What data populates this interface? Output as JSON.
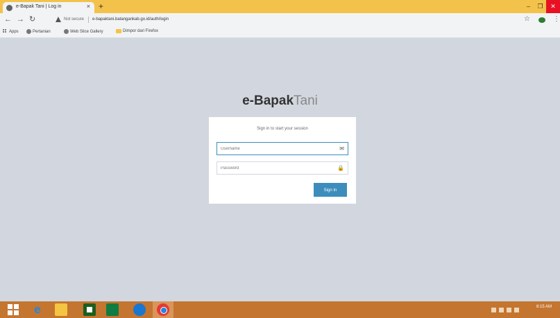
{
  "browser": {
    "tab_title": "e-Bapak Tani | Log in",
    "address": {
      "security_label": "Not secure",
      "url": "e-bapaktani.batangankab.go.id/auth/login"
    }
  },
  "bookmarks": [
    {
      "label": "Apps",
      "icon": "apps-grid-icon"
    },
    {
      "label": "Pertanian",
      "icon": "globe-icon"
    },
    {
      "label": "Web Slice Gallery",
      "icon": "globe-icon"
    },
    {
      "label": "Dimpor dari Firefox",
      "icon": "folder-icon"
    }
  ],
  "login": {
    "logo_bold": "e-Bapak",
    "logo_light": "Tani",
    "message": "Sign in to start your session",
    "username_placeholder": "Username",
    "password_placeholder": "Password",
    "signin_label": "Sign In"
  },
  "taskbar": {
    "clock_time": "8:15 AM"
  },
  "colors": {
    "page_bg": "#d2d6de",
    "primary": "#3c8dbc",
    "title_bar": "#f3c24a",
    "taskbar": "#c4752f"
  }
}
